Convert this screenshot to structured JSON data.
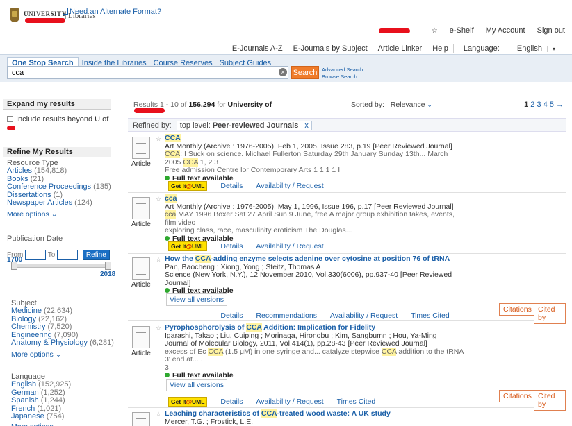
{
  "header": {
    "logo_university": "UNIVERSITY",
    "logo_libraries": "Libraries",
    "alt_format": "Need an Alternate Format?",
    "top_links": [
      "e-Shelf",
      "My Account",
      "Sign out"
    ],
    "nav_links": [
      "E-Journals A-Z",
      "E-Journals by Subject",
      "Article Linker",
      "Help",
      "Language:"
    ],
    "language_value": "English"
  },
  "search": {
    "tabs": [
      "One Stop Search",
      "Inside the Libraries",
      "Course Reserves",
      "Subject Guides"
    ],
    "query": "cca",
    "button": "Search",
    "advanced": "Advanced Search",
    "browse": "Browse Search"
  },
  "sidebar": {
    "expand_title": "Expand my results",
    "include_beyond": "Include results beyond U of",
    "refine_title": "Refine My Results",
    "resource_type_title": "Resource Type",
    "resource_types": [
      {
        "label": "Articles",
        "count": "(154,818)"
      },
      {
        "label": "Books",
        "count": "(21)"
      },
      {
        "label": "Conference Proceedings",
        "count": "(135)"
      },
      {
        "label": "Dissertations",
        "count": "(1)"
      },
      {
        "label": "Newspaper Articles",
        "count": "(124)"
      }
    ],
    "more_options": "More options",
    "pub_date_title": "Publication Date",
    "from_label": "From",
    "to_label": "To",
    "refine_btn": "Refine",
    "year_min": "1700",
    "year_max": "2018",
    "subject_title": "Subject",
    "subjects": [
      {
        "label": "Medicine",
        "count": "(22,634)"
      },
      {
        "label": "Biology",
        "count": "(22,162)"
      },
      {
        "label": "Chemistry",
        "count": "(7,520)"
      },
      {
        "label": "Engineering",
        "count": "(7,090)"
      },
      {
        "label": "Anatomy & Physiology",
        "count": "(6,281)"
      }
    ],
    "language_title": "Language",
    "languages": [
      {
        "label": "English",
        "count": "(152,925)"
      },
      {
        "label": "German",
        "count": "(1,252)"
      },
      {
        "label": "Spanish",
        "count": "(1,244)"
      },
      {
        "label": "French",
        "count": "(1,021)"
      },
      {
        "label": "Japanese",
        "count": "(754)"
      }
    ]
  },
  "results": {
    "label_results": "Results",
    "range": "1 - 10",
    "of": "of",
    "total": "156,294",
    "for": "for",
    "scope": "University of",
    "sorted_by": "Sorted by:",
    "sort_value": "Relevance",
    "pages": [
      "1",
      "2",
      "3",
      "4",
      "5"
    ],
    "refined_by": "Refined by:",
    "chip_label": "top level:",
    "chip_value": "Peer-reviewed Journals",
    "chip_x": "x",
    "full_text": "Full text available",
    "getit_a": "Get It",
    "getit_o": "@",
    "getit_b": "UML",
    "view_versions": "View all versions",
    "citations": "Citations",
    "cited_by": "Cited by",
    "doc_type": "Article",
    "records": [
      {
        "title": "CCA",
        "source": "Art Monthly (Archive : 1976-2005), Feb 1, 2005, Issue 283, p.19 [Peer Reviewed Journal]",
        "snippet1": "CCA: I Suck on science. Michael Fullerton Saturday 29th January Sunday 13th... March 2005 CCA 1, 2 3",
        "snippet2": "Free admission Centre lor Contemporary Arts 1 1 1 1 I",
        "links": [
          "Details",
          "Availability / Request"
        ]
      },
      {
        "title": "cca",
        "source": "Art Monthly (Archive : 1976-2005), May 1, 1996, Issue 196, p.17 [Peer Reviewed Journal]",
        "snippet1": "cca MAY 1996 Boxer Sat 27 April Sun 9 June, free A major group exhibition takes, events, film video",
        "snippet2": "exploring class, race, masculinity eroticism The Douglas...",
        "links": [
          "Details",
          "Availability / Request"
        ]
      },
      {
        "title": "How the CCA-adding enzyme selects adenine over cytosine at position 76 of tRNA",
        "authors": "Pan, Baocheng ; Xiong, Yong ; Steitz, Thomas A",
        "source": "Science (New York, N.Y.), 12 November 2010, Vol.330(6006), pp.937-40 [Peer Reviewed Journal]",
        "links": [
          "Details",
          "Recommendations",
          "Availability / Request",
          "Times Cited"
        ]
      },
      {
        "title": "Pyrophosphorolysis of CCA Addition: Implication for Fidelity",
        "authors": "Igarashi, Takao ; Liu, Cuiping ; Morinaga, Hironobu ; Kim, Sangbumn ; Hou, Ya-Ming",
        "source": "Journal of Molecular Biology, 2011, Vol.414(1), pp.28-43 [Peer Reviewed Journal]",
        "snippet1": "excess of Ec CCA (1.5 μM) in one syringe and... catalyze stepwise CCA addition to the tRNA 3' end at... .",
        "snippet2": "3",
        "links": [
          "Details",
          "Availability / Request",
          "Times Cited"
        ]
      },
      {
        "title": "Leaching characteristics of CCA-treated wood waste: A UK study",
        "authors": "Mercer, T.G. ; Frostick, L.E."
      }
    ]
  }
}
